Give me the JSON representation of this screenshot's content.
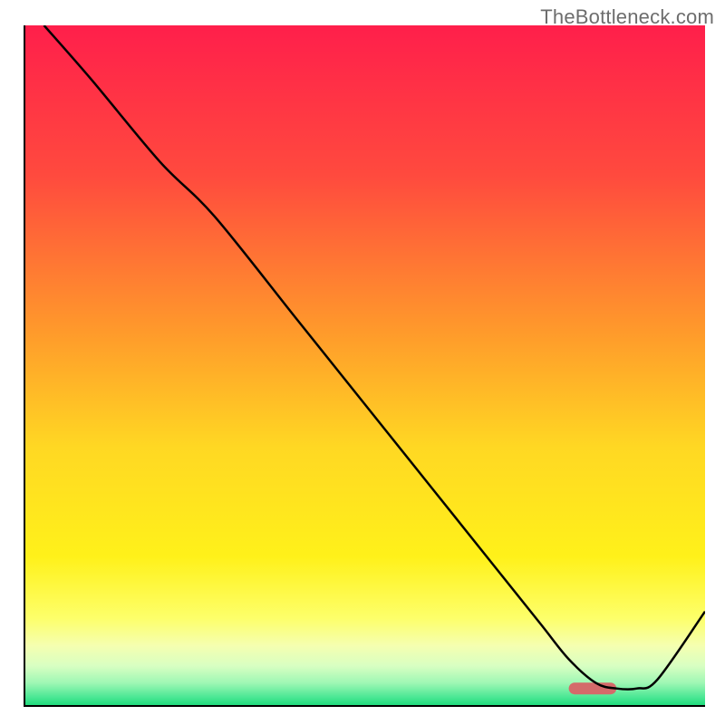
{
  "watermark": "TheBottleneck.com",
  "chart_data": {
    "type": "line",
    "title": "",
    "xlabel": "",
    "ylabel": "",
    "xlim": [
      0,
      100
    ],
    "ylim": [
      0,
      100
    ],
    "grid": false,
    "legend": false,
    "curve": {
      "x": [
        3,
        10,
        20,
        28,
        40,
        50,
        60,
        70,
        76,
        80,
        84,
        87,
        90,
        93,
        100
      ],
      "y": [
        100,
        92,
        80,
        72,
        57,
        44.5,
        32,
        19.5,
        12,
        7,
        3.5,
        2.7,
        2.7,
        4,
        14
      ]
    },
    "optimum_marker": {
      "x_start": 80,
      "x_end": 87,
      "y": 2.7,
      "color": "#d46a6a"
    },
    "background_gradient_stops": [
      {
        "offset": 0,
        "color": "#ff1f4b"
      },
      {
        "offset": 0.22,
        "color": "#ff4a3e"
      },
      {
        "offset": 0.45,
        "color": "#ff9a2b"
      },
      {
        "offset": 0.62,
        "color": "#ffd823"
      },
      {
        "offset": 0.78,
        "color": "#fff11a"
      },
      {
        "offset": 0.87,
        "color": "#fdff6a"
      },
      {
        "offset": 0.91,
        "color": "#f5ffb0"
      },
      {
        "offset": 0.94,
        "color": "#d8ffc2"
      },
      {
        "offset": 0.965,
        "color": "#9ef7b4"
      },
      {
        "offset": 0.985,
        "color": "#4ee896"
      },
      {
        "offset": 1,
        "color": "#17d977"
      }
    ],
    "axis_color": "#000000",
    "axis_width": 4,
    "curve_color": "#000000",
    "curve_width": 2.5
  }
}
